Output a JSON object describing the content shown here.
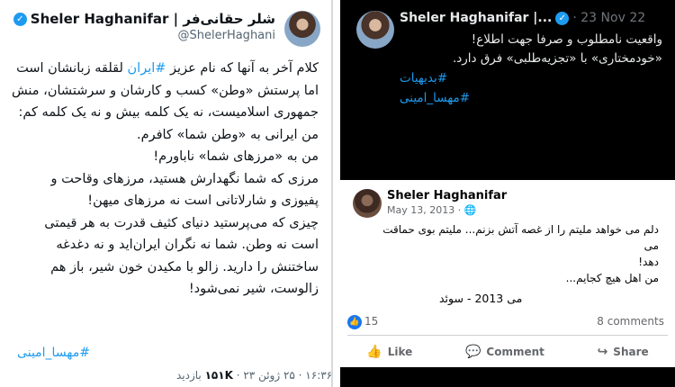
{
  "left_tweet": {
    "display_name": "Sheler Haghanifar | شلر حقانی‌فر",
    "handle": "@ShelerHaghani",
    "body_lines": [
      "کلام آخر به آنها که نام عزیز #ایران لقلقه زبانشان است",
      "اما پرستش «وطن» کسب و کارشان و سرشتشان، منش",
      "جمهوری اسلامیست، نه یک کلمه بیش و نه یک کلمه کم:",
      "من ایرانی به «وطن شما» کافرم.",
      "من به «مرزهای شما» ناباورم!",
      "مرزی که شما نگهدارش هستید، مرزهای وقاحت و",
      "پفیوزی و شارلاتانی است نه مرزهای میهن!",
      "چیزی که می‌پرستید دنیای کثیف قدرت به هر قیمتی",
      "است نه وطن. شما نه نگران ایران‌اید و نه دغدغه",
      "ساختنش را دارید. زالو با مکیدن خون شیر، باز هم",
      "زالوست، شیر نمی‌شود!"
    ],
    "hashtag": "#مهسا_امینی",
    "footer_time": "۱۶:۳۶ · ۲۵ ژوئن ۲۳ ·",
    "footer_views_count": "۱۵۱K",
    "footer_views_label": "بازدید"
  },
  "right_tweet": {
    "display_name": "Sheler Haghanifar |...",
    "date": "· 23 Nov 22",
    "body_line1": "واقعیت نامطلوب و صرفا جهت اطلاع!",
    "body_line2": "«خودمختاری» با «تجزیه‌طلبی» فرق دارد.",
    "hashtags": [
      "#بدیهیات",
      "#مهسا_امینی"
    ]
  },
  "fb_post": {
    "name": "Sheler Haghanifar",
    "date": "May 13, 2013 · ",
    "body_line1": "دلم می خواهد ملیتم را از غصه آتش بزنم... ملیتم بوی حماقت می",
    "body_line2": "دهد!",
    "body_line3": "من اهل هیچ کجایم...",
    "caption": "می 2013 - سوئد",
    "likes": "15",
    "comments": "8 comments",
    "actions": [
      "Like",
      "Comment",
      "Share"
    ]
  },
  "colors": {
    "twitter_blue": "#1d9bf0",
    "facebook_blue": "#1877f2",
    "dark_bg": "#000000"
  }
}
